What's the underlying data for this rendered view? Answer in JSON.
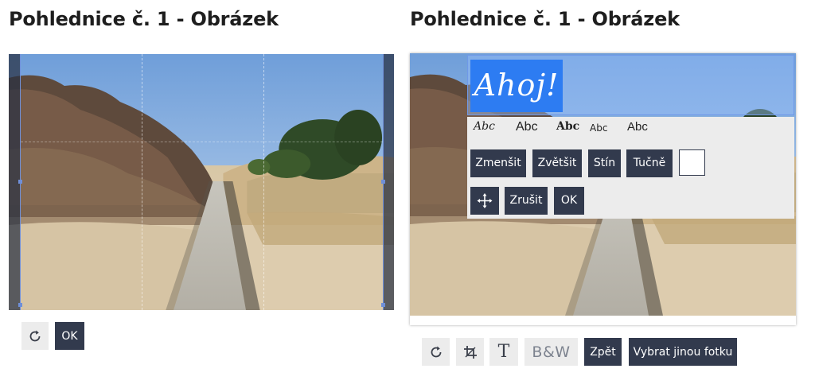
{
  "left_panel": {
    "title": "Pohlednice č. 1 - Obrázek",
    "toolbar": {
      "rotate_icon": "rotate-icon",
      "ok_label": "OK"
    }
  },
  "right_panel": {
    "title": "Pohlednice č. 1 - Obrázek",
    "text_overlay": "Ahoj!",
    "font_options": [
      "Abc",
      "Abc",
      "Abc",
      "Abc",
      "Abc"
    ],
    "buttons": {
      "shrink": "Zmenšit",
      "enlarge": "Zvětšit",
      "shadow": "Stín",
      "bold": "Tučně",
      "cancel": "Zrušit",
      "ok": "OK"
    },
    "text_color": "#ffffff",
    "toolbar": {
      "rotate_icon": "rotate-icon",
      "crop_icon": "crop-icon",
      "text_icon": "T",
      "bw_label": "B&W",
      "back_label": "Zpět",
      "choose_photo_label": "Vybrat jinou fotku"
    }
  },
  "colors": {
    "dark_button": "#323a4d",
    "light_button": "#ececec",
    "highlight": "#2d7cf2"
  }
}
